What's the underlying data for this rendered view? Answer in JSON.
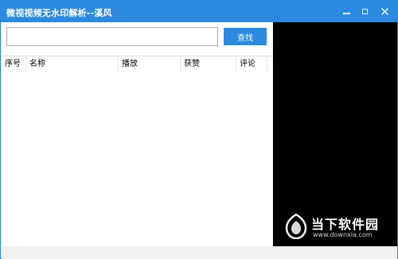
{
  "window": {
    "title": "微视视频无水印解析--溪风"
  },
  "search": {
    "value": "",
    "placeholder": "",
    "button_label": "查找"
  },
  "table": {
    "columns": [
      "序号",
      "名称",
      "播放",
      "获赞",
      "评论"
    ],
    "rows": []
  },
  "watermark": {
    "text": "当下软件园",
    "url": "www.downxia.com"
  },
  "colors": {
    "accent": "#2b8ae0",
    "preview_background": "#000000"
  },
  "icons": {
    "minimize": "minimize-icon",
    "maximize": "maximize-icon",
    "close": "close-icon",
    "watermark_logo": "downxia-logo-icon"
  }
}
